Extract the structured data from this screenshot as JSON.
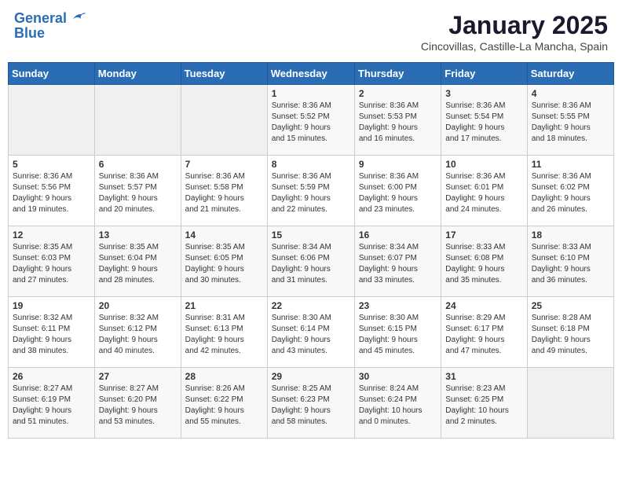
{
  "header": {
    "logo_line1": "General",
    "logo_line2": "Blue",
    "month": "January 2025",
    "location": "Cincovillas, Castille-La Mancha, Spain"
  },
  "weekdays": [
    "Sunday",
    "Monday",
    "Tuesday",
    "Wednesday",
    "Thursday",
    "Friday",
    "Saturday"
  ],
  "weeks": [
    [
      {
        "day": "",
        "info": ""
      },
      {
        "day": "",
        "info": ""
      },
      {
        "day": "",
        "info": ""
      },
      {
        "day": "1",
        "info": "Sunrise: 8:36 AM\nSunset: 5:52 PM\nDaylight: 9 hours\nand 15 minutes."
      },
      {
        "day": "2",
        "info": "Sunrise: 8:36 AM\nSunset: 5:53 PM\nDaylight: 9 hours\nand 16 minutes."
      },
      {
        "day": "3",
        "info": "Sunrise: 8:36 AM\nSunset: 5:54 PM\nDaylight: 9 hours\nand 17 minutes."
      },
      {
        "day": "4",
        "info": "Sunrise: 8:36 AM\nSunset: 5:55 PM\nDaylight: 9 hours\nand 18 minutes."
      }
    ],
    [
      {
        "day": "5",
        "info": "Sunrise: 8:36 AM\nSunset: 5:56 PM\nDaylight: 9 hours\nand 19 minutes."
      },
      {
        "day": "6",
        "info": "Sunrise: 8:36 AM\nSunset: 5:57 PM\nDaylight: 9 hours\nand 20 minutes."
      },
      {
        "day": "7",
        "info": "Sunrise: 8:36 AM\nSunset: 5:58 PM\nDaylight: 9 hours\nand 21 minutes."
      },
      {
        "day": "8",
        "info": "Sunrise: 8:36 AM\nSunset: 5:59 PM\nDaylight: 9 hours\nand 22 minutes."
      },
      {
        "day": "9",
        "info": "Sunrise: 8:36 AM\nSunset: 6:00 PM\nDaylight: 9 hours\nand 23 minutes."
      },
      {
        "day": "10",
        "info": "Sunrise: 8:36 AM\nSunset: 6:01 PM\nDaylight: 9 hours\nand 24 minutes."
      },
      {
        "day": "11",
        "info": "Sunrise: 8:36 AM\nSunset: 6:02 PM\nDaylight: 9 hours\nand 26 minutes."
      }
    ],
    [
      {
        "day": "12",
        "info": "Sunrise: 8:35 AM\nSunset: 6:03 PM\nDaylight: 9 hours\nand 27 minutes."
      },
      {
        "day": "13",
        "info": "Sunrise: 8:35 AM\nSunset: 6:04 PM\nDaylight: 9 hours\nand 28 minutes."
      },
      {
        "day": "14",
        "info": "Sunrise: 8:35 AM\nSunset: 6:05 PM\nDaylight: 9 hours\nand 30 minutes."
      },
      {
        "day": "15",
        "info": "Sunrise: 8:34 AM\nSunset: 6:06 PM\nDaylight: 9 hours\nand 31 minutes."
      },
      {
        "day": "16",
        "info": "Sunrise: 8:34 AM\nSunset: 6:07 PM\nDaylight: 9 hours\nand 33 minutes."
      },
      {
        "day": "17",
        "info": "Sunrise: 8:33 AM\nSunset: 6:08 PM\nDaylight: 9 hours\nand 35 minutes."
      },
      {
        "day": "18",
        "info": "Sunrise: 8:33 AM\nSunset: 6:10 PM\nDaylight: 9 hours\nand 36 minutes."
      }
    ],
    [
      {
        "day": "19",
        "info": "Sunrise: 8:32 AM\nSunset: 6:11 PM\nDaylight: 9 hours\nand 38 minutes."
      },
      {
        "day": "20",
        "info": "Sunrise: 8:32 AM\nSunset: 6:12 PM\nDaylight: 9 hours\nand 40 minutes."
      },
      {
        "day": "21",
        "info": "Sunrise: 8:31 AM\nSunset: 6:13 PM\nDaylight: 9 hours\nand 42 minutes."
      },
      {
        "day": "22",
        "info": "Sunrise: 8:30 AM\nSunset: 6:14 PM\nDaylight: 9 hours\nand 43 minutes."
      },
      {
        "day": "23",
        "info": "Sunrise: 8:30 AM\nSunset: 6:15 PM\nDaylight: 9 hours\nand 45 minutes."
      },
      {
        "day": "24",
        "info": "Sunrise: 8:29 AM\nSunset: 6:17 PM\nDaylight: 9 hours\nand 47 minutes."
      },
      {
        "day": "25",
        "info": "Sunrise: 8:28 AM\nSunset: 6:18 PM\nDaylight: 9 hours\nand 49 minutes."
      }
    ],
    [
      {
        "day": "26",
        "info": "Sunrise: 8:27 AM\nSunset: 6:19 PM\nDaylight: 9 hours\nand 51 minutes."
      },
      {
        "day": "27",
        "info": "Sunrise: 8:27 AM\nSunset: 6:20 PM\nDaylight: 9 hours\nand 53 minutes."
      },
      {
        "day": "28",
        "info": "Sunrise: 8:26 AM\nSunset: 6:22 PM\nDaylight: 9 hours\nand 55 minutes."
      },
      {
        "day": "29",
        "info": "Sunrise: 8:25 AM\nSunset: 6:23 PM\nDaylight: 9 hours\nand 58 minutes."
      },
      {
        "day": "30",
        "info": "Sunrise: 8:24 AM\nSunset: 6:24 PM\nDaylight: 10 hours\nand 0 minutes."
      },
      {
        "day": "31",
        "info": "Sunrise: 8:23 AM\nSunset: 6:25 PM\nDaylight: 10 hours\nand 2 minutes."
      },
      {
        "day": "",
        "info": ""
      }
    ]
  ]
}
